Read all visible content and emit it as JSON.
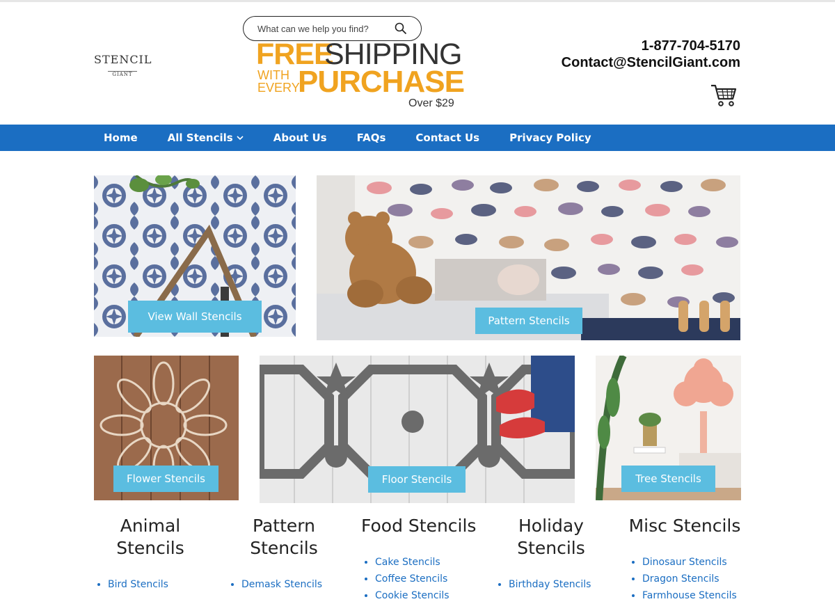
{
  "header": {
    "logo_line1": "STENCIL",
    "logo_line2": "GIANT",
    "search_placeholder": "What can we help you find?",
    "promo": {
      "free": "FREE",
      "shipping": "SHIPPING",
      "with": "WITH",
      "every": "EVERY",
      "purchase": "PURCHASE",
      "over": "Over $29"
    },
    "phone": "1-877-704-5170",
    "email": "Contact@StencilGiant.com"
  },
  "nav": {
    "items": [
      {
        "label": "Home"
      },
      {
        "label": "All Stencils"
      },
      {
        "label": "About Us"
      },
      {
        "label": "FAQs"
      },
      {
        "label": "Contact Us"
      },
      {
        "label": "Privacy Policy"
      }
    ]
  },
  "tiles": {
    "wall": "View Wall Stencils",
    "pattern": "Pattern Stencils",
    "flower": "Flower Stencils",
    "floor": "Floor Stencils",
    "tree": "Tree Stencils"
  },
  "categories": [
    {
      "title_line1": "Animal",
      "title_line2": "Stencils",
      "links": [
        "Bird Stencils"
      ]
    },
    {
      "title_line1": "Pattern",
      "title_line2": "Stencils",
      "links": [
        "Demask Stencils"
      ]
    },
    {
      "title_line1": "Food Stencils",
      "title_line2": "",
      "links": [
        "Cake Stencils",
        "Coffee Stencils",
        "Cookie Stencils"
      ]
    },
    {
      "title_line1": "Holiday",
      "title_line2": "Stencils",
      "links": [
        "Birthday Stencils"
      ]
    },
    {
      "title_line1": "Misc Stencils",
      "title_line2": "",
      "links": [
        "Dinosaur Stencils",
        "Dragon Stencils",
        "Farmhouse Stencils"
      ]
    }
  ],
  "colors": {
    "nav_bg": "#1b6ec2",
    "button_bg": "#5bbde0",
    "promo_orange": "#f0a320",
    "link": "#1b6ec2"
  }
}
